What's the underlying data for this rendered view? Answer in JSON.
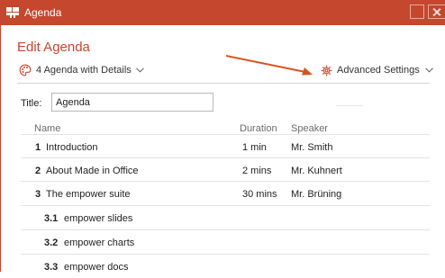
{
  "window": {
    "title": "Agenda",
    "icon": "empower-app-icon",
    "accent_color": "#c4472e"
  },
  "dialog": {
    "heading": "Edit Agenda",
    "agenda_type": "4 Agenda with Details",
    "advanced_settings": "Advanced Settings",
    "title_label": "Title:",
    "title_value": "Agenda"
  },
  "table": {
    "columns": [
      "Name",
      "Duration",
      "Speaker"
    ],
    "rows": [
      {
        "num": "1",
        "name": "Introduction",
        "duration": "1 min",
        "speaker": "Mr. Smith"
      },
      {
        "num": "2",
        "name": "About Made in Office",
        "duration": "2 mins",
        "speaker": "Mr. Kuhnert"
      },
      {
        "num": "3",
        "name": "The empower suite",
        "duration": "30 mins",
        "speaker": "Mr. Brüning"
      },
      {
        "num": "3.1",
        "name": "empower slides",
        "duration": "",
        "speaker": ""
      },
      {
        "num": "3.2",
        "name": "empower charts",
        "duration": "",
        "speaker": ""
      },
      {
        "num": "3.3",
        "name": "empower docs",
        "duration": "",
        "speaker": ""
      }
    ]
  }
}
